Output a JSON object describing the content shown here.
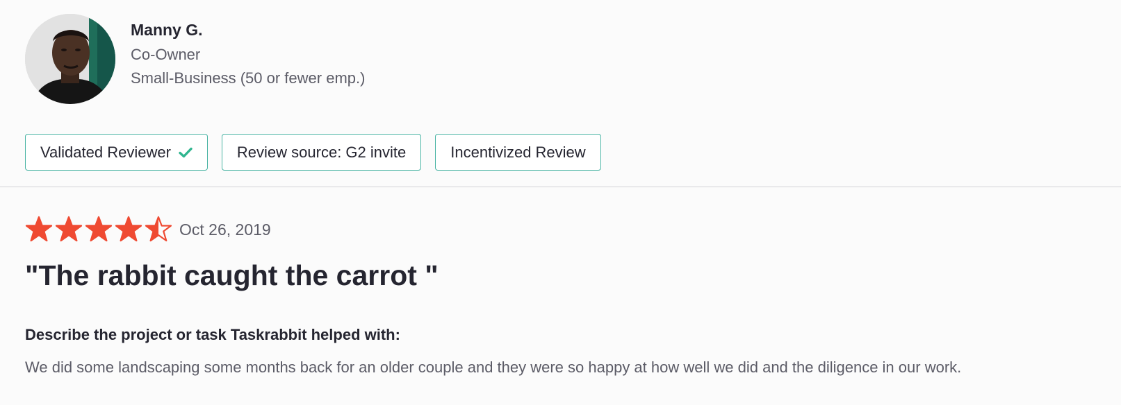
{
  "reviewer": {
    "name": "Manny G.",
    "title": "Co-Owner",
    "company_size": "Small-Business (50 or fewer emp.)"
  },
  "badges": [
    {
      "label": "Validated Reviewer",
      "icon": "check-icon"
    },
    {
      "label": "Review source: G2 invite"
    },
    {
      "label": "Incentivized Review"
    }
  ],
  "review": {
    "rating": 4.5,
    "rating_max": 5,
    "date": "Oct 26, 2019",
    "title": "\"The rabbit caught the carrot \"",
    "question": "Describe the project or task Taskrabbit helped with:",
    "answer": "We did some landscaping some months back for an older couple and they were so happy at how well we did and the diligence in our work."
  },
  "colors": {
    "star": "#ef4a32",
    "badge_border": "#48b3a3",
    "check": "#2fb58f",
    "divider": "#d2d2d6"
  }
}
